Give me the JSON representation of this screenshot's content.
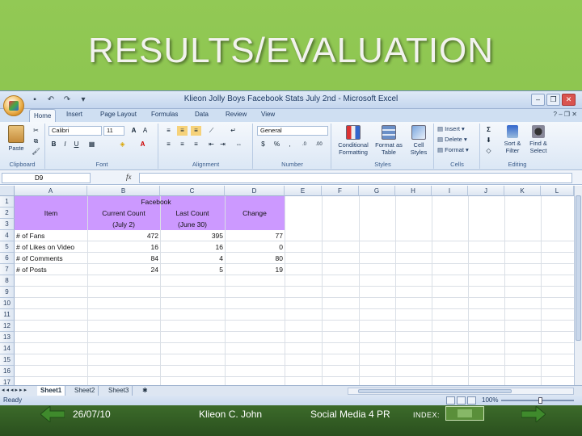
{
  "slide": {
    "title": "RESULTS/EVALUATION",
    "footer": {
      "date": "26/07/10",
      "author": "Klieon C. John",
      "course": "Social Media 4 PR",
      "index_label": "INDEX:"
    }
  },
  "excel": {
    "window_title": "Klieon Jolly Boys Facebook Stats July 2nd - Microsoft Excel",
    "tabs": [
      "Home",
      "Insert",
      "Page Layout",
      "Formulas",
      "Data",
      "Review",
      "View"
    ],
    "ribbon": {
      "clipboard": {
        "label": "Clipboard",
        "paste": "Paste"
      },
      "font": {
        "label": "Font",
        "family": "Calibri",
        "size": "11"
      },
      "alignment": {
        "label": "Alignment"
      },
      "number": {
        "label": "Number",
        "format": "General"
      },
      "styles": {
        "label": "Styles",
        "conditional": "Conditional Formatting",
        "format_table": "Format as Table",
        "cell_styles": "Cell Styles"
      },
      "cells": {
        "label": "Cells",
        "insert": "Insert",
        "delete": "Delete",
        "format": "Format"
      },
      "editing": {
        "label": "Editing",
        "sort": "Sort & Filter",
        "find": "Find & Select"
      }
    },
    "name_box": "D9",
    "fx": "fx",
    "columns": [
      "A",
      "B",
      "C",
      "D",
      "E",
      "F",
      "G",
      "H",
      "I",
      "J",
      "K",
      "L"
    ],
    "rows": [
      "1",
      "2",
      "3",
      "4",
      "5",
      "6",
      "7",
      "8",
      "9",
      "10",
      "11",
      "12",
      "13",
      "14",
      "15",
      "16",
      "17"
    ],
    "table": {
      "header_top": "Facebook",
      "col_item": "Item",
      "col_current_1": "Current Count",
      "col_current_2": "(July 2)",
      "col_last_1": "Last Count",
      "col_last_2": "(June 30)",
      "col_change": "Change",
      "rows": [
        {
          "item": "# of Fans",
          "current": "472",
          "last": "395",
          "change": "77"
        },
        {
          "item": "# of Likes on Video",
          "current": "16",
          "last": "16",
          "change": "0"
        },
        {
          "item": "# of Comments",
          "current": "84",
          "last": "4",
          "change": "80"
        },
        {
          "item": "# of Posts",
          "current": "24",
          "last": "5",
          "change": "19"
        }
      ]
    },
    "sheets": [
      "Sheet1",
      "Sheet2",
      "Sheet3"
    ],
    "status": "Ready",
    "zoom": "100%"
  }
}
